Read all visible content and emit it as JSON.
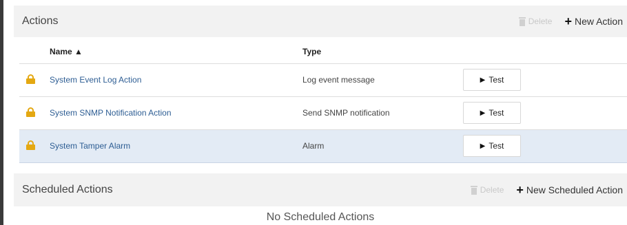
{
  "actions_panel": {
    "title": "Actions",
    "delete_label": "Delete",
    "new_label": "New Action",
    "columns": {
      "name": "Name ▲",
      "type": "Type"
    },
    "rows": [
      {
        "name": "System Event Log Action",
        "type": "Log event message",
        "test_label": "Test"
      },
      {
        "name": "System SNMP Notification Action",
        "type": "Send SNMP notification",
        "test_label": "Test"
      },
      {
        "name": "System Tamper Alarm",
        "type": "Alarm",
        "test_label": "Test"
      }
    ]
  },
  "scheduled_panel": {
    "title": "Scheduled Actions",
    "delete_label": "Delete",
    "new_label": "New Scheduled Action",
    "empty_message": "No Scheduled Actions"
  },
  "icons": {
    "lock": "lock-icon",
    "play": "play-icon",
    "plus": "plus-icon",
    "trash": "trash-icon"
  },
  "colors": {
    "link": "#2d5d93",
    "lock": "#e4a812",
    "selected_row": "#e3ebf5",
    "header_bg": "#f2f2f2"
  }
}
